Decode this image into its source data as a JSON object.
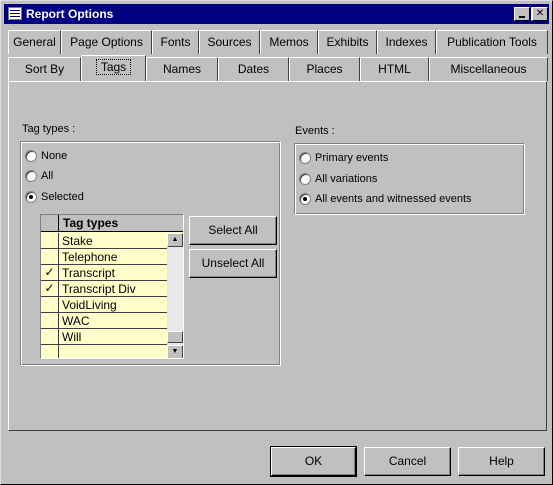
{
  "window": {
    "title": "Report Options"
  },
  "tabs_row1": [
    {
      "label": "General"
    },
    {
      "label": "Page Options"
    },
    {
      "label": "Fonts"
    },
    {
      "label": "Sources"
    },
    {
      "label": "Memos"
    },
    {
      "label": "Exhibits"
    },
    {
      "label": "Indexes"
    },
    {
      "label": "Publication Tools"
    }
  ],
  "tabs_row2": [
    {
      "label": "Sort By"
    },
    {
      "label": "Tags",
      "active": true
    },
    {
      "label": "Names"
    },
    {
      "label": "Dates"
    },
    {
      "label": "Places"
    },
    {
      "label": "HTML"
    },
    {
      "label": "Miscellaneous"
    }
  ],
  "tag_types": {
    "group_label": "Tag types :",
    "options": [
      {
        "label": "None",
        "checked": false
      },
      {
        "label": "All",
        "checked": false
      },
      {
        "label": "Selected",
        "checked": true
      }
    ],
    "grid_header": "Tag types",
    "rows": [
      {
        "name": "Stake",
        "checked": false
      },
      {
        "name": "Telephone",
        "checked": false
      },
      {
        "name": "Transcript",
        "checked": true
      },
      {
        "name": "Transcript Div",
        "checked": true
      },
      {
        "name": "VoidLiving",
        "checked": false
      },
      {
        "name": "WAC",
        "checked": false
      },
      {
        "name": "Will",
        "checked": false
      },
      {
        "name": "",
        "checked": false
      }
    ],
    "check_mark": "✓",
    "select_all_label": "Select All",
    "unselect_all_label": "Unselect All"
  },
  "events": {
    "group_label": "Events :",
    "options": [
      {
        "label": "Primary events",
        "checked": false
      },
      {
        "label": "All variations",
        "checked": false
      },
      {
        "label": "All events and witnessed events",
        "checked": true
      }
    ]
  },
  "buttons": {
    "ok": "OK",
    "cancel": "Cancel",
    "help": "Help"
  }
}
